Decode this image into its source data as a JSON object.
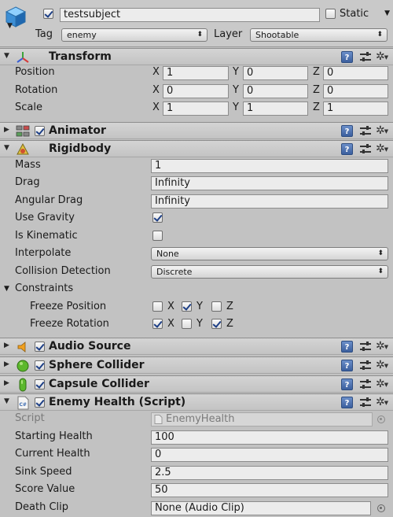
{
  "object": {
    "name": "testsubject",
    "active": true,
    "static_label": "Static",
    "static_checked": false,
    "tag_label": "Tag",
    "tag_value": "enemy",
    "layer_label": "Layer",
    "layer_value": "Shootable"
  },
  "transform": {
    "title": "Transform",
    "position_label": "Position",
    "rotation_label": "Rotation",
    "scale_label": "Scale",
    "axis_x": "X",
    "axis_y": "Y",
    "axis_z": "Z",
    "position": {
      "x": "1",
      "y": "0",
      "z": "0"
    },
    "rotation": {
      "x": "0",
      "y": "0",
      "z": "0"
    },
    "scale": {
      "x": "1",
      "y": "1",
      "z": "1"
    }
  },
  "animator": {
    "title": "Animator",
    "enabled": true
  },
  "rigidbody": {
    "title": "Rigidbody",
    "mass_label": "Mass",
    "mass": "1",
    "drag_label": "Drag",
    "drag": "Infinity",
    "angular_drag_label": "Angular Drag",
    "angular_drag": "Infinity",
    "use_gravity_label": "Use Gravity",
    "use_gravity": true,
    "is_kinematic_label": "Is Kinematic",
    "is_kinematic": false,
    "interpolate_label": "Interpolate",
    "interpolate": "None",
    "collision_detection_label": "Collision Detection",
    "collision_detection": "Discrete",
    "constraints_label": "Constraints",
    "freeze_position_label": "Freeze Position",
    "freeze_rotation_label": "Freeze Rotation",
    "freeze_position": {
      "x": false,
      "y": true,
      "z": false
    },
    "freeze_rotation": {
      "x": true,
      "y": false,
      "z": true
    }
  },
  "audio_source": {
    "title": "Audio Source",
    "enabled": true
  },
  "sphere_collider": {
    "title": "Sphere Collider",
    "enabled": true
  },
  "capsule_collider": {
    "title": "Capsule Collider",
    "enabled": true
  },
  "enemy_health": {
    "title": "Enemy Health (Script)",
    "enabled": true,
    "script_label": "Script",
    "script": "EnemyHealth",
    "starting_health_label": "Starting Health",
    "starting_health": "100",
    "current_health_label": "Current Health",
    "current_health": "0",
    "sink_speed_label": "Sink Speed",
    "sink_speed": "2.5",
    "score_value_label": "Score Value",
    "score_value": "50",
    "death_clip_label": "Death Clip",
    "death_clip": "None (Audio Clip)"
  },
  "icons": {
    "help": "help-book-icon",
    "preset": "preset-sliders-icon",
    "settings": "gear-icon",
    "help_glyph": "?"
  },
  "colors": {
    "background": "#c2c2c2",
    "header": "#c9c9c9",
    "accent_blue": "#3b5f9e"
  }
}
